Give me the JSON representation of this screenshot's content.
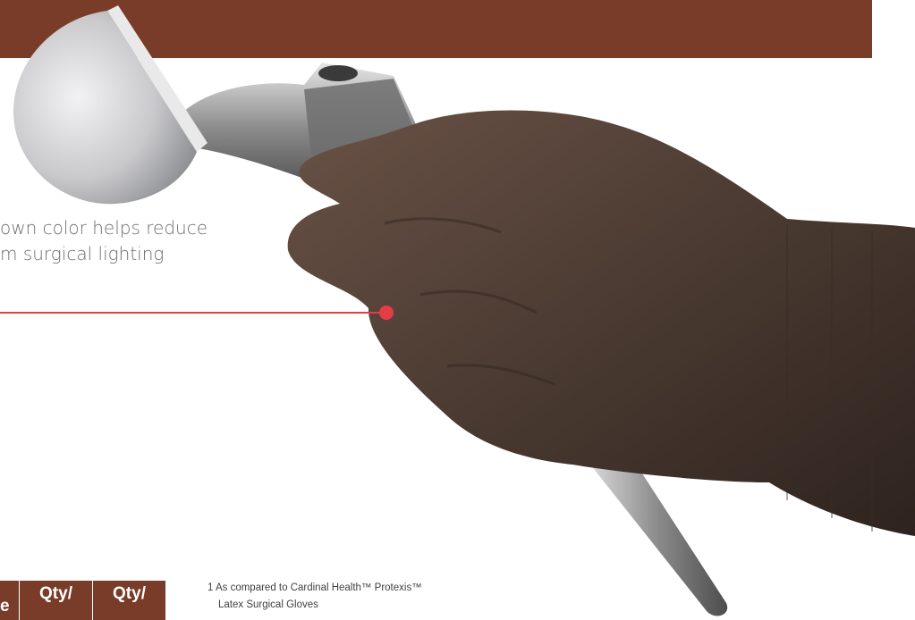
{
  "colors": {
    "brand_brown": "#793c29",
    "callout_red": "#e63c46",
    "text_gray": "#6d6e70",
    "glove_brown": "#4e3a31"
  },
  "callout": {
    "line1": "own color helps reduce",
    "line2": "m surgical lighting"
  },
  "table": {
    "headers": [
      "e",
      "Qty/",
      "Qty/"
    ]
  },
  "footnote": {
    "line1": "1 As compared to Cardinal Health™ Protexis™",
    "line2": "Latex Surgical Gloves"
  },
  "icons": [
    "hip-implant-icon",
    "gloved-hand-icon"
  ]
}
